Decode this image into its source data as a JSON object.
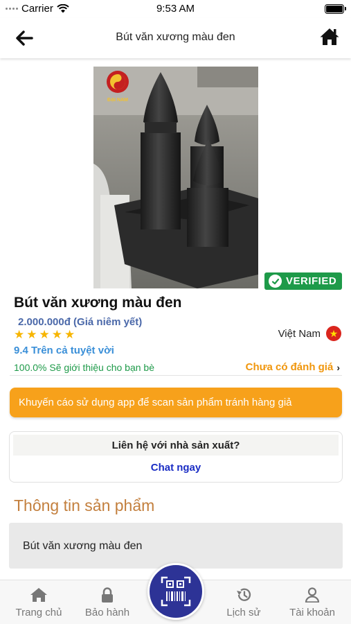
{
  "status_bar": {
    "carrier": "Carrier",
    "time": "9:53 AM"
  },
  "header": {
    "title": "Bút văn xương màu đen"
  },
  "product": {
    "name": "Bút văn xương màu đen",
    "price": "2.000.000đ (Giá niêm yết)",
    "rating_stars": 5,
    "origin": "Việt Nam",
    "score": "9.4 Trên cả tuyệt vời",
    "recommend": "100.0% Sẽ giới thiệu cho bạn bè",
    "review_link": "Chưa có đánh giá",
    "badge": "VERIFIED",
    "watermark": "ĐẠI NAM"
  },
  "warning": "Khuyến cáo sử dụng app để scan sản phẩm tránh hàng giả",
  "contact": {
    "question": "Liên hệ với nhà sản xuất?",
    "chat_label": "Chat ngay"
  },
  "section": {
    "title": "Thông tin sản phẩm",
    "description": "Bút văn xương màu đen"
  },
  "nav": {
    "home": "Trang chủ",
    "warranty": "Bảo hành",
    "history": "Lịch sử",
    "account": "Tài khoản"
  },
  "colors": {
    "accent_orange": "#f7a11b",
    "verified_green": "#1e9a49",
    "price_blue": "#4a68a9",
    "chat_blue": "#1a2dc4",
    "scan_button": "#2d3396",
    "section_title": "#c37f3d"
  },
  "icons": {
    "back": "arrow-left-icon",
    "home": "home-icon",
    "scan": "qr-barcode-scan-icon",
    "warranty": "lock-icon",
    "history": "history-icon",
    "account": "user-icon"
  }
}
